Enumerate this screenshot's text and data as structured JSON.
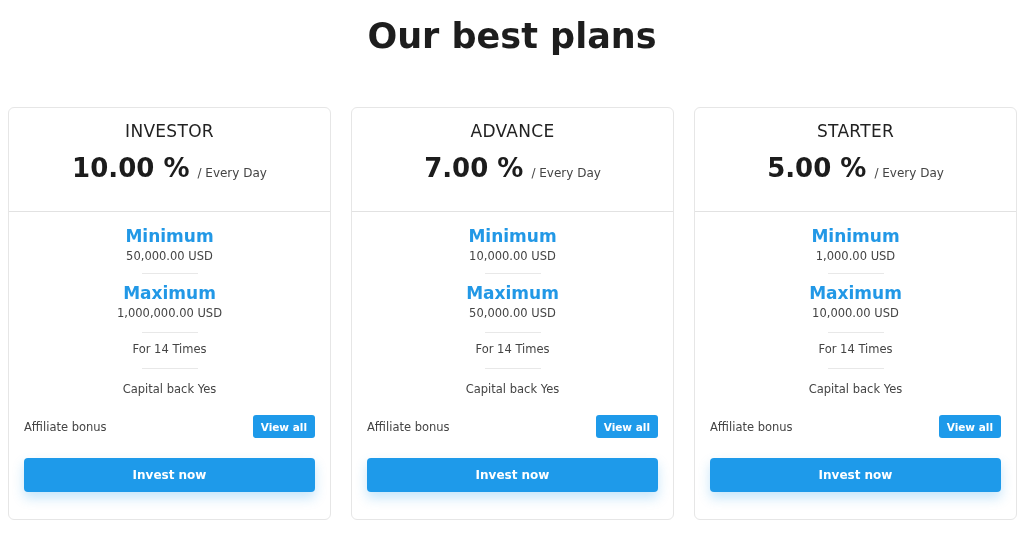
{
  "heading": "Our best plans",
  "plans": [
    {
      "name": "INVESTOR",
      "rate": "10.00 %",
      "period": "/ Every Day",
      "minimum_label": "Minimum",
      "minimum": "50,000.00 USD",
      "maximum_label": "Maximum",
      "maximum": "1,000,000.00 USD",
      "times": "For 14 Times",
      "capital_back": "Capital back Yes",
      "affiliate": "Affiliate bonus",
      "view_button": "View all",
      "invest_button": "Invest now"
    },
    {
      "name": "ADVANCE",
      "rate": "7.00 %",
      "period": "/ Every Day",
      "minimum_label": "Minimum",
      "minimum": "10,000.00 USD",
      "maximum_label": "Maximum",
      "maximum": "50,000.00 USD",
      "times": "For 14 Times",
      "capital_back": "Capital back Yes",
      "affiliate": "Affiliate bonus",
      "view_button": "View all",
      "invest_button": "Invest now"
    },
    {
      "name": "STARTER",
      "rate": "5.00 %",
      "period": "/ Every Day",
      "minimum_label": "Minimum",
      "minimum": "1,000.00 USD",
      "maximum_label": "Maximum",
      "maximum": "10,000.00 USD",
      "times": "For 14 Times",
      "capital_back": "Capital back Yes",
      "affiliate": "Affiliate bonus",
      "view_button": "View all",
      "invest_button": "Invest now"
    }
  ]
}
